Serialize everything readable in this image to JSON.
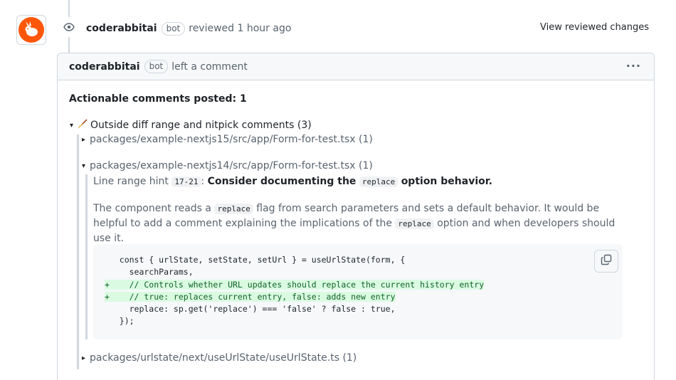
{
  "review": {
    "author": "coderabbitai",
    "bot_label": "bot",
    "action_text": "reviewed 1 hour ago",
    "view_changes_label": "View reviewed changes"
  },
  "comment": {
    "author": "coderabbitai",
    "bot_label": "bot",
    "action_text": "left a comment",
    "menu_glyph": "···",
    "actionable_title": "Actionable comments posted: 1",
    "outside_diff": {
      "toggle": "▾",
      "label": "Outside diff range and nitpick comments (3)"
    },
    "files": [
      {
        "toggle": "▸",
        "path": "packages/example-nextjs15/src/app/Form-for-test.tsx (1)"
      },
      {
        "toggle": "▾",
        "path": "packages/example-nextjs14/src/app/Form-for-test.tsx (1)"
      },
      {
        "toggle": "▸",
        "path": "packages/urlstate/next/useUrlState/useUrlState.ts (1)"
      }
    ],
    "hint": {
      "prefix": "Line range hint",
      "range": "17-21",
      "sep": ":",
      "title_a": "Consider documenting the",
      "title_code": "replace",
      "title_b": "option behavior."
    },
    "desc": {
      "part1": "The component reads a",
      "code1": "replace",
      "part2": "flag from search parameters and sets a default behavior. It would be helpful to add a comment explaining the implications of the",
      "code2": "replace",
      "part3": "option and when developers should use it."
    },
    "code_lines": [
      {
        "prefix": "  ",
        "text": "const { urlState, setState, setUrl } = useUrlState(form, {"
      },
      {
        "prefix": "  ",
        "text": "  searchParams,"
      },
      {
        "prefix": "+ ",
        "text": "  // Controls whether URL updates should replace the current history entry"
      },
      {
        "prefix": "+ ",
        "text": "  // true: replaces current entry, false: adds new entry"
      },
      {
        "prefix": "  ",
        "text": "  replace: sp.get('replace') === 'false' ? false : true,"
      },
      {
        "prefix": "  ",
        "text": "});"
      }
    ]
  },
  "colors": {
    "brand": "#ff570a",
    "addition_bg": "#dafbe1",
    "addition_text": "#116329"
  },
  "icons": {
    "avatar": "coderabbit-logo-icon",
    "review": "eye-icon",
    "copy": "copy-icon",
    "outside_diff": "broom-icon"
  }
}
